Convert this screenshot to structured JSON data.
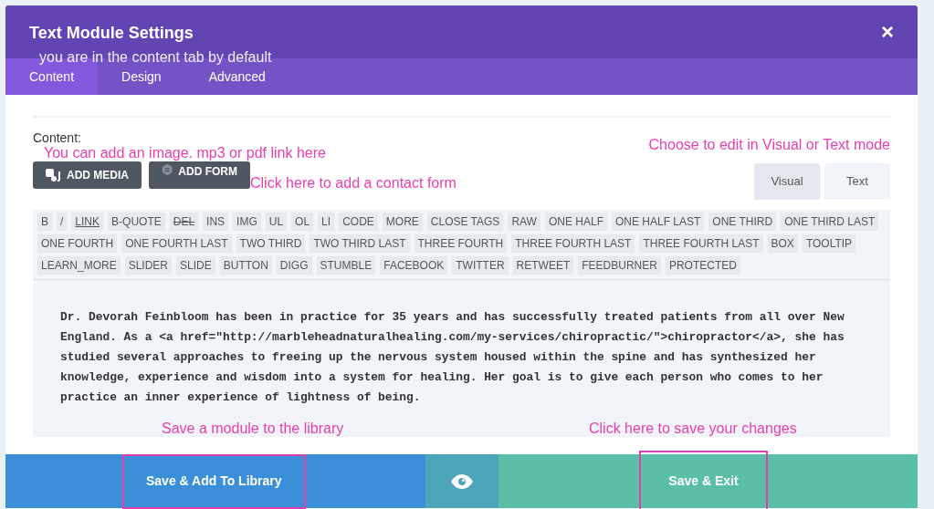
{
  "dialog": {
    "title": "Text Module Settings",
    "close": "×"
  },
  "tabs": [
    {
      "label": "Content",
      "selected": true
    },
    {
      "label": "Design",
      "selected": false
    },
    {
      "label": "Advanced",
      "selected": false
    }
  ],
  "tabs_note": "you are in the content tab by default",
  "content_label": "Content:",
  "media_note": "You can add an image. mp3 or pdf link here",
  "form_note": "Click here to add a contact form",
  "mode_note": "Choose to edit in Visual or Text mode",
  "media_buttons": [
    {
      "label": "ADD MEDIA",
      "kind": "media"
    },
    {
      "label": "ADD FORM",
      "kind": "form"
    }
  ],
  "mode_tabs": [
    {
      "label": "Visual",
      "selected": false
    },
    {
      "label": "Text",
      "selected": true
    }
  ],
  "quicktags": [
    {
      "label": "B",
      "kind": "plain"
    },
    {
      "label": "/",
      "kind": "plain"
    },
    {
      "label": "LINK",
      "kind": "underline"
    },
    {
      "label": "B-QUOTE",
      "kind": "plain"
    },
    {
      "label": "DEL",
      "kind": "strike"
    },
    {
      "label": "INS",
      "kind": "plain"
    },
    {
      "label": "IMG",
      "kind": "plain"
    },
    {
      "label": "UL",
      "kind": "plain"
    },
    {
      "label": "OL",
      "kind": "plain"
    },
    {
      "label": "LI",
      "kind": "plain"
    },
    {
      "label": "CODE",
      "kind": "plain"
    },
    {
      "label": "MORE",
      "kind": "plain"
    },
    {
      "label": "CLOSE TAGS",
      "kind": "plain"
    },
    {
      "label": "RAW",
      "kind": "plain"
    },
    {
      "label": "ONE HALF",
      "kind": "plain"
    },
    {
      "label": "ONE HALF LAST",
      "kind": "plain"
    },
    {
      "label": "ONE THIRD",
      "kind": "plain"
    },
    {
      "label": "ONE THIRD LAST",
      "kind": "plain"
    },
    {
      "label": "ONE FOURTH",
      "kind": "plain"
    },
    {
      "label": "ONE FOURTH LAST",
      "kind": "plain"
    },
    {
      "label": "TWO THIRD",
      "kind": "plain"
    },
    {
      "label": "TWO THIRD LAST",
      "kind": "plain"
    },
    {
      "label": "THREE FOURTH",
      "kind": "plain"
    },
    {
      "label": "THREE FOURTH LAST",
      "kind": "plain"
    },
    {
      "label": "THREE FOURTH LAST",
      "kind": "plain"
    },
    {
      "label": "BOX",
      "kind": "plain"
    },
    {
      "label": "TOOLTIP",
      "kind": "plain"
    },
    {
      "label": "LEARN_MORE",
      "kind": "plain"
    },
    {
      "label": "SLIDER",
      "kind": "plain"
    },
    {
      "label": "SLIDE",
      "kind": "plain"
    },
    {
      "label": "BUTTON",
      "kind": "plain"
    },
    {
      "label": "DIGG",
      "kind": "plain"
    },
    {
      "label": "STUMBLE",
      "kind": "plain"
    },
    {
      "label": "FACEBOOK",
      "kind": "plain"
    },
    {
      "label": "TWITTER",
      "kind": "plain"
    },
    {
      "label": "RETWEET",
      "kind": "plain"
    },
    {
      "label": "FEEDBURNER",
      "kind": "plain"
    },
    {
      "label": "PROTECTED",
      "kind": "plain"
    }
  ],
  "editor_text": "Dr. Devorah Feinbloom has been in practice for 35 years and has successfully treated patients from all over New England. As a <a href=\"http://marbleheadnaturalhealing.com/my-services/chiropractic/\">chiropractor</a>, she has studied several approaches to freeing up the nervous system housed within the spine and has synthesized her knowledge, experience and wisdom into a system for healing. Her goal is to give each person who comes to her practice an inner experience of lightness of being.",
  "library_note": "Save a module to the library",
  "exit_note": "Click here to save your changes",
  "footer": {
    "library_button": {
      "label": "Save & Add To Library",
      "highlighted": true
    },
    "exit_button": {
      "label": "Save & Exit",
      "highlighted": true
    }
  }
}
